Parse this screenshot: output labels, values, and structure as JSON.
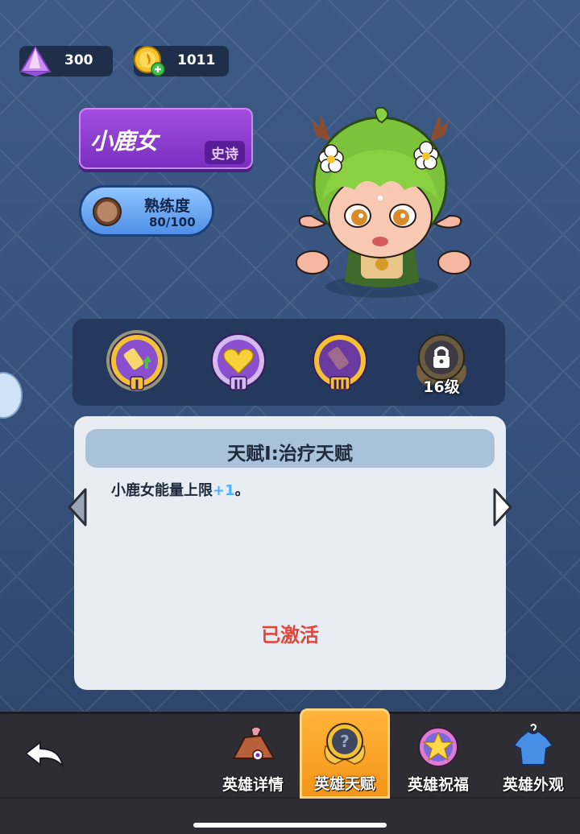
{
  "currency": {
    "gems": "300",
    "coins": "1011"
  },
  "hero": {
    "name": "小鹿女",
    "rarity": "史诗",
    "proficiency_label": "熟练度",
    "proficiency_value": "80/100"
  },
  "talents": [
    {
      "roman": "I",
      "state": "selected"
    },
    {
      "roman": "II",
      "state": "unlocked"
    },
    {
      "roman": "III",
      "state": "unlocked"
    },
    {
      "roman": "",
      "state": "locked",
      "level_label": "16级"
    }
  ],
  "panel": {
    "title": "天赋Ⅰ:治疗天赋",
    "description_prefix": "小鹿女能量上限",
    "description_bonus": "+1",
    "description_suffix": "。",
    "status": "已激活"
  },
  "tabs": [
    {
      "label": "英雄详情",
      "active": false,
      "icon": "hero-details-icon"
    },
    {
      "label": "英雄天赋",
      "active": true,
      "icon": "hero-talent-icon"
    },
    {
      "label": "英雄祝福",
      "active": false,
      "icon": "hero-blessing-icon"
    },
    {
      "label": "英雄外观",
      "active": false,
      "icon": "hero-appearance-icon"
    }
  ],
  "colors": {
    "accent_orange": "#f49518",
    "status_red": "#e0463c",
    "rarity_purple": "#7a2fc0",
    "bonus_blue": "#4ab5ff"
  }
}
